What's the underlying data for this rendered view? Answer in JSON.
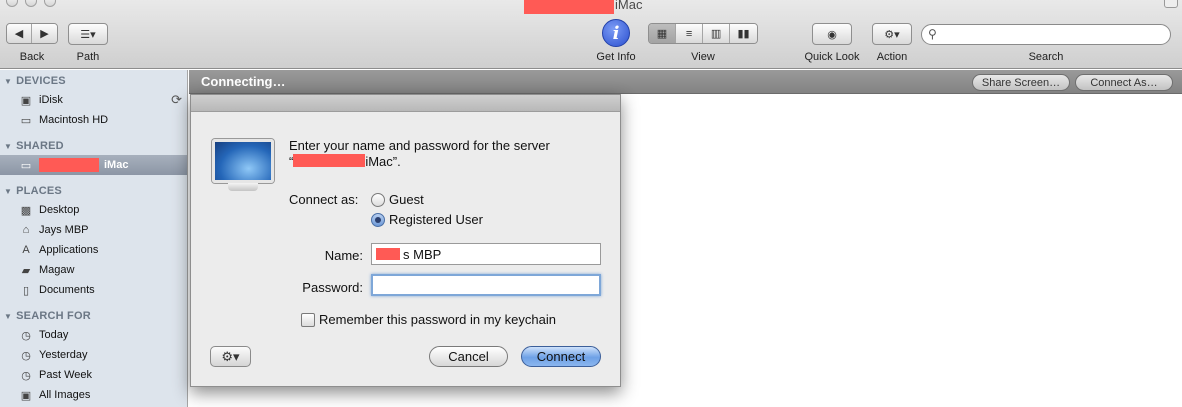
{
  "window": {
    "title": "iMac"
  },
  "toolbar": {
    "back_label": "Back",
    "path_label": "Path",
    "get_info_label": "Get Info",
    "view_label": "View",
    "quick_look_label": "Quick Look",
    "action_label": "Action",
    "search_label": "Search",
    "search_placeholder": ""
  },
  "sidebar": {
    "devices_header": "DEVICES",
    "devices": [
      {
        "label": "iDisk",
        "icon": "idisk-icon"
      },
      {
        "label": "Macintosh HD",
        "icon": "hard-drive-icon"
      }
    ],
    "shared_header": "SHARED",
    "shared": [
      {
        "label": "iMac",
        "icon": "imac-icon",
        "selected": true
      }
    ],
    "places_header": "PLACES",
    "places": [
      {
        "label": "Desktop",
        "icon": "desktop-icon"
      },
      {
        "label": "Jays MBP",
        "icon": "home-icon"
      },
      {
        "label": "Applications",
        "icon": "applications-icon"
      },
      {
        "label": "Magaw",
        "icon": "folder-icon"
      },
      {
        "label": "Documents",
        "icon": "documents-icon"
      }
    ],
    "search_header": "SEARCH FOR",
    "searches": [
      {
        "label": "Today",
        "icon": "clock-icon"
      },
      {
        "label": "Yesterday",
        "icon": "clock-icon"
      },
      {
        "label": "Past Week",
        "icon": "clock-icon"
      },
      {
        "label": "All Images",
        "icon": "images-icon"
      }
    ]
  },
  "main": {
    "status": "Connecting…",
    "share_screen_label": "Share Screen…",
    "connect_as_label": "Connect As…"
  },
  "dialog": {
    "prompt_line1": "Enter your name and password for the server",
    "prompt_line2_prefix": "“",
    "prompt_line2_suffix": "iMac”.",
    "connect_as_label": "Connect as:",
    "guest_label": "Guest",
    "registered_label": "Registered User",
    "selected_option": "Registered User",
    "name_label": "Name:",
    "name_value": "s MBP",
    "password_label": "Password:",
    "password_value": "",
    "remember_label": "Remember this password in my keychain",
    "remember_checked": false,
    "cancel_label": "Cancel",
    "connect_label": "Connect"
  }
}
